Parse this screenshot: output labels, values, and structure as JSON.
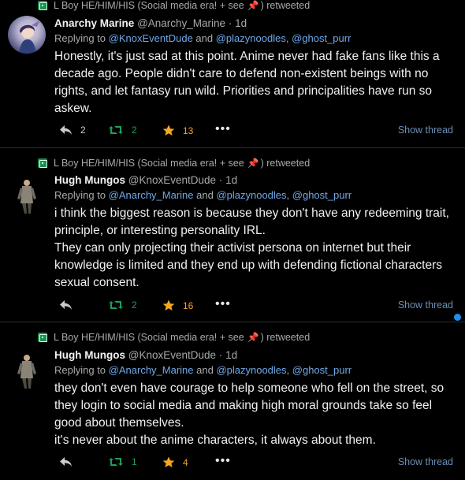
{
  "tweets": [
    {
      "retweet_line": {
        "prefix": "L Boy HE/HIM/HIS (Social media era! + see ",
        "pin": "📌",
        "suffix": ") retweeted"
      },
      "display_name": "Anarchy Marine",
      "handle": "@Anarchy_Marine",
      "time": "1d",
      "replying_to": {
        "prefix": "Replying to ",
        "m1": "@KnoxEventDude",
        "and": " and ",
        "m2": "@plazynoodles",
        "comma": ", ",
        "m3": "@ghost_purr"
      },
      "body": [
        "Honestly, it's just sad at this point. Anime never had fake fans like this a decade ago. People didn't care to defend non-existent beings with no rights, and let fantasy run wild. Priorities and principalities have run so askew."
      ],
      "replies": "2",
      "retweets": "2",
      "likes": "13",
      "show_thread": "Show thread"
    },
    {
      "retweet_line": {
        "prefix": "L Boy HE/HIM/HIS (Social media era! + see ",
        "pin": "📌",
        "suffix": ") retweeted"
      },
      "display_name": "Hugh Mungos",
      "handle": "@KnoxEventDude",
      "time": "1d",
      "replying_to": {
        "prefix": "Replying to ",
        "m1": "@Anarchy_Marine",
        "and": " and ",
        "m2": "@plazynoodles",
        "comma": ", ",
        "m3": "@ghost_purr"
      },
      "body": [
        "i think the biggest reason is because they don't have any redeeming trait, principle, or interesting personality IRL.",
        "They can only projecting their activist persona on internet but their knowledge is limited and they end up with defending fictional characters sexual consent."
      ],
      "replies": "",
      "retweets": "2",
      "likes": "16",
      "show_thread": "Show thread"
    },
    {
      "retweet_line": {
        "prefix": "L Boy HE/HIM/HIS (Social media era! + see ",
        "pin": "📌",
        "suffix": ") retweeted"
      },
      "display_name": "Hugh Mungos",
      "handle": "@KnoxEventDude",
      "time": "1d",
      "replying_to": {
        "prefix": "Replying to ",
        "m1": "@Anarchy_Marine",
        "and": " and ",
        "m2": "@plazynoodles",
        "comma": ", ",
        "m3": "@ghost_purr"
      },
      "body": [
        "they don't even have courage to help someone who fell on the street, so they login to social media and making high moral grounds take so feel good about themselves.",
        "it's never about the anime characters, it always about them."
      ],
      "replies": "",
      "retweets": "1",
      "likes": "4",
      "show_thread": "Show thread"
    }
  ],
  "colors": {
    "background": "#000000",
    "mention": "#6fa8e8",
    "retweet": "#1e9e58",
    "like": "#f5a623",
    "unread_dot": "#1d8ff0"
  },
  "icons": [
    "retweet-icon",
    "reply-icon",
    "star-icon",
    "more-icon",
    "pin-icon"
  ]
}
